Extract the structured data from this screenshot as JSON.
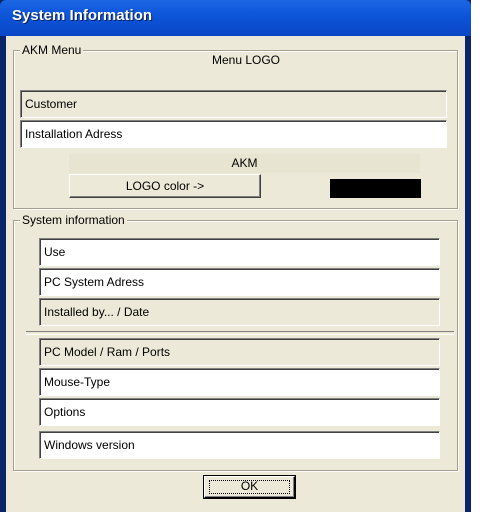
{
  "window": {
    "title": "System Information"
  },
  "akm_menu": {
    "group_label": "AKM Menu",
    "menu_logo_label": "Menu LOGO",
    "customer": "Customer",
    "installation_address": "Installation Adress",
    "akm_label": "AKM",
    "logo_color_button": "LOGO color ->",
    "logo_color": "#000000"
  },
  "system_info": {
    "group_label": "System information",
    "use": "Use",
    "pc_system_address": "PC System Adress",
    "installed_by": "Installed by... / Date",
    "pc_model": "PC Model / Ram / Ports",
    "mouse_type": "Mouse-Type",
    "options": "Options",
    "windows_version": "Windows version"
  },
  "buttons": {
    "ok_label": "OK"
  }
}
